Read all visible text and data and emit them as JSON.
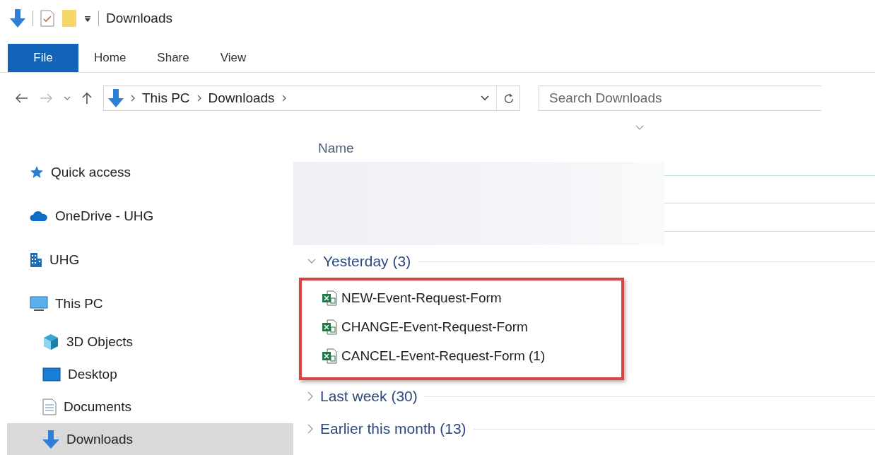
{
  "title_bar": {
    "title": "Downloads"
  },
  "ribbon_tabs": [
    {
      "label": "File",
      "kind": "menu"
    },
    {
      "label": "Home",
      "kind": "tab"
    },
    {
      "label": "Share",
      "kind": "tab"
    },
    {
      "label": "View",
      "kind": "tab"
    }
  ],
  "address_bar": {
    "path": [
      "This PC",
      "Downloads"
    ]
  },
  "search": {
    "placeholder": "Search Downloads"
  },
  "sidebar": {
    "items": [
      {
        "label": "Quick access",
        "kind": "star",
        "selected": false
      },
      {
        "label": "OneDrive - UHG",
        "kind": "cloud",
        "selected": false
      },
      {
        "label": "UHG",
        "kind": "building",
        "selected": false
      },
      {
        "label": "This PC",
        "kind": "computer",
        "selected": false,
        "children": [
          {
            "label": "3D Objects",
            "kind": "cube",
            "selected": false
          },
          {
            "label": "Desktop",
            "kind": "desktop",
            "selected": false
          },
          {
            "label": "Documents",
            "kind": "document",
            "selected": false
          },
          {
            "label": "Downloads",
            "kind": "download",
            "selected": true
          }
        ]
      }
    ]
  },
  "file_list": {
    "column": "Name",
    "groups": [
      {
        "label": "Yesterday (3)",
        "expanded": true,
        "highlighted": true,
        "files": [
          "NEW-Event-Request-Form",
          "CHANGE-Event-Request-Form",
          "CANCEL-Event-Request-Form (1)"
        ]
      },
      {
        "label": "Last week (30)",
        "expanded": false,
        "highlighted": false
      },
      {
        "label": "Earlier this month (13)",
        "expanded": false,
        "highlighted": false
      }
    ]
  }
}
